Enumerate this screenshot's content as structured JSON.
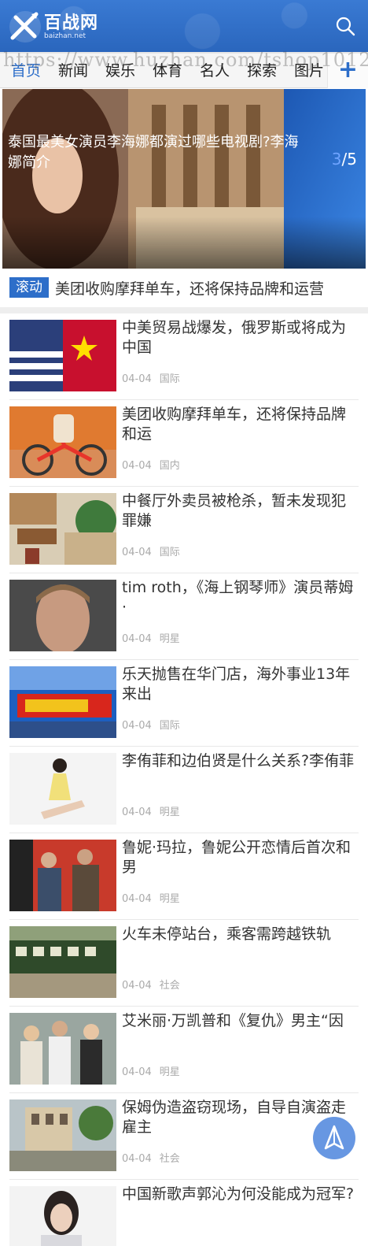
{
  "header": {
    "logo_title": "百战网",
    "logo_sub": "baizhan.net",
    "search_icon": "search-icon",
    "logo_icon": "baizhan-logo-mark"
  },
  "nav": {
    "items": [
      "首页",
      "新闻",
      "娱乐",
      "体育",
      "名人",
      "探索",
      "图片"
    ],
    "active": "首页",
    "more_label": "+"
  },
  "banner": {
    "title": "泰国最美女演员李海娜都演过哪些电视剧?李海娜简介",
    "page_current": "3",
    "page_total": "/5"
  },
  "ticker": {
    "tag": "滚动",
    "text": "美团收购摩拜单车，还将保持品牌和运营"
  },
  "watermark": "https://www.huzhan.com/tshop1012",
  "articles": [
    {
      "title": "中美贸易战爆发，俄罗斯或将成为中国",
      "date": "04-04",
      "category": "国际",
      "thumb": "flags"
    },
    {
      "title": "美团收购摩拜单车，还将保持品牌和运",
      "date": "04-04",
      "category": "国内",
      "thumb": "bike"
    },
    {
      "title": "中餐厅外卖员被枪杀，暂未发现犯罪嫌",
      "date": "04-04",
      "category": "国际",
      "thumb": "restaurant"
    },
    {
      "title": "tim roth，《海上钢琴师》演员蒂姆·",
      "date": "04-04",
      "category": "明星",
      "thumb": "portrait"
    },
    {
      "title": "乐天抛售在华门店，海外事业13年来出",
      "date": "04-04",
      "category": "国际",
      "thumb": "store"
    },
    {
      "title": "李侑菲和边伯贤是什么关系?李侑菲",
      "date": "04-04",
      "category": "明星",
      "thumb": "woman"
    },
    {
      "title": "鲁妮·玛拉，鲁妮公开恋情后首次和男",
      "date": "04-04",
      "category": "明星",
      "thumb": "couple"
    },
    {
      "title": "火车未停站台，乘客需跨越铁轨",
      "date": "04-04",
      "category": "社会",
      "thumb": "train"
    },
    {
      "title": "艾米丽·万凯普和《复仇》男主“因",
      "date": "04-04",
      "category": "明星",
      "thumb": "group"
    },
    {
      "title": "保姆伪造盗窃现场，自导自演盗走雇主",
      "date": "04-04",
      "category": "社会",
      "thumb": "street"
    },
    {
      "title": "中国新歌声郭沁为何没能成为冠军?",
      "date": "",
      "category": "",
      "thumb": "singer"
    }
  ],
  "float_button": {
    "icon": "paper-plane-icon"
  },
  "colors": {
    "brand": "#2d6ec9",
    "meta": "#aaaaaa",
    "nav_bg": "#f5f5f5"
  }
}
